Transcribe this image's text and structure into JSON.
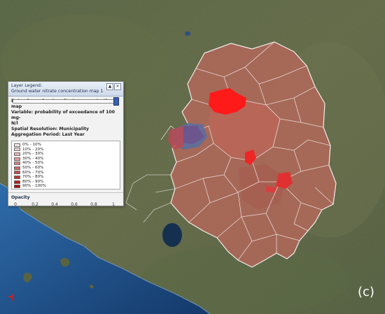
{
  "legend": {
    "title_line1": "Layer Legend:",
    "title_line2": "Ground water nitrate concentration map 1",
    "data": "Data: Ground water nitrate concentration map",
    "variable_a": "Variable: probability of exceedance of 100 mg-",
    "variable_b": "N/l",
    "resolution": "Spatial Resolution: Municipality",
    "aggregation": "Aggregation Period: Last Year",
    "classes": [
      {
        "label": "0% - 10%",
        "color": "#f4e7e7"
      },
      {
        "label": "10% - 20%",
        "color": "#f0d0d0"
      },
      {
        "label": "20% - 30%",
        "color": "#e8b4b4"
      },
      {
        "label": "30% - 40%",
        "color": "#e09a9a"
      },
      {
        "label": "40% - 50%",
        "color": "#d88080"
      },
      {
        "label": "50% - 60%",
        "color": "#d06464"
      },
      {
        "label": "60% - 70%",
        "color": "#c84848"
      },
      {
        "label": "70% - 80%",
        "color": "#c03030"
      },
      {
        "label": "80% - 90%",
        "color": "#b81818"
      },
      {
        "label": "90% - 100%",
        "color": "#b00000"
      }
    ],
    "opacity_title": "Opacity",
    "opacity_ticks": [
      "0",
      "0.2",
      "0.4",
      "0.6",
      "0.8",
      "1"
    ],
    "opacity_value": 1
  },
  "panel_label": "(c)",
  "colors": {
    "region_fill": "#b5685a",
    "hotspot": "#ff1a1a",
    "boundary": "#f2ecec",
    "sea": "#1e4f86",
    "lake": "#14304e"
  }
}
